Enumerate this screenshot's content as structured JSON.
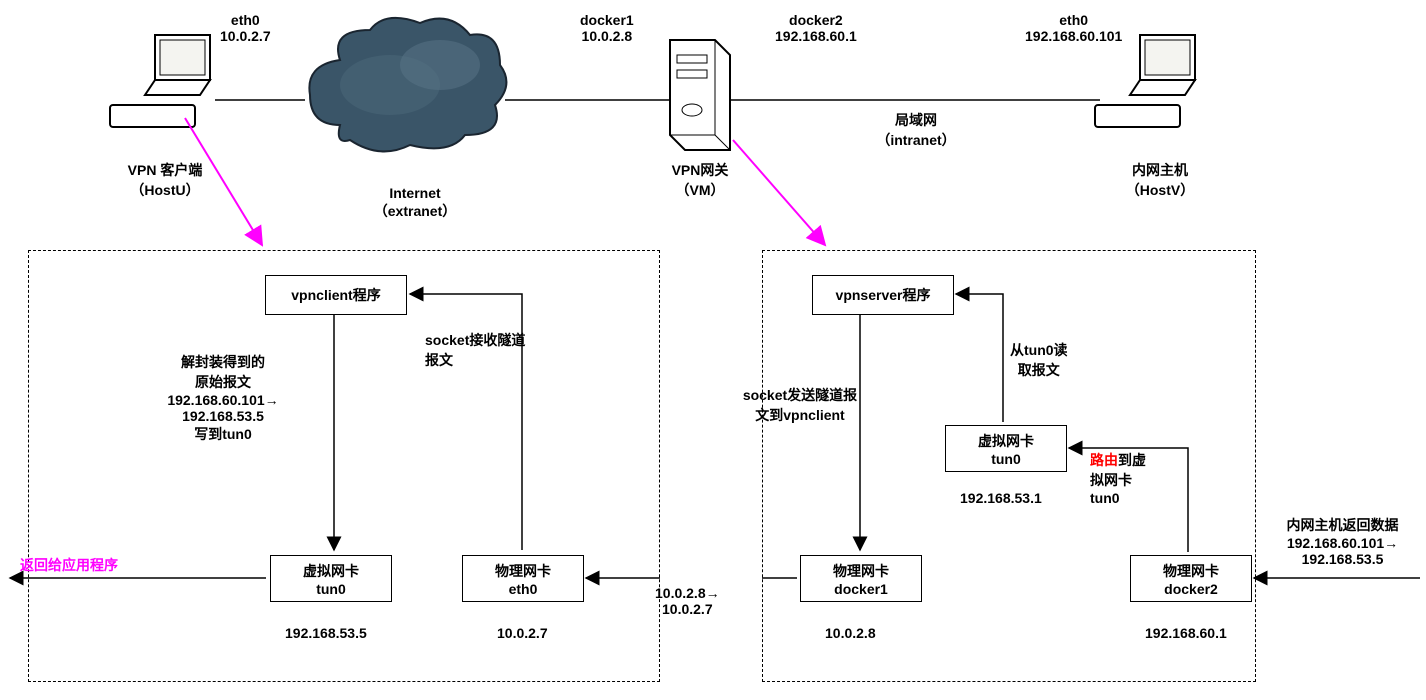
{
  "top": {
    "hostU": {
      "if": "eth0",
      "ip": "10.0.2.7",
      "name": "VPN 客户端",
      "sub": "（HostU）"
    },
    "internet": {
      "name": "Internet",
      "sub": "（extranet）"
    },
    "vm": {
      "if1": "docker1",
      "ip1": "10.0.2.8",
      "if2": "docker2",
      "ip2": "192.168.60.1",
      "name": "VPN网关",
      "sub": "（VM）"
    },
    "lan": {
      "name": "局域网",
      "sub": "（intranet）"
    },
    "hostV": {
      "if": "eth0",
      "ip": "192.168.60.101",
      "name": "内网主机",
      "sub": "（HostV）"
    }
  },
  "left": {
    "prog": "vpnclient程序",
    "decap1": "解封装得到的",
    "decap2": "原始报文",
    "decap3": "192.168.60.101→",
    "decap4": "192.168.53.5",
    "decap5": "写到tun0",
    "sock1": "socket接收隧道",
    "sock2": "报文",
    "vnic1": "虚拟网卡",
    "vnic2": "tun0",
    "vnicip": "192.168.53.5",
    "pnic1": "物理网卡",
    "pnic2": "eth0",
    "pnicip": "10.0.2.7",
    "out": "返回给应用程序"
  },
  "mid": {
    "l1": "10.0.2.8→",
    "l2": "10.0.2.7"
  },
  "right": {
    "prog": "vpnserver程序",
    "send1": "socket发送隧道报",
    "send2": "文到vpnclient",
    "read1": "从tun0读",
    "read2": "取报文",
    "vnic1": "虚拟网卡",
    "vnic2": "tun0",
    "vnicip": "192.168.53.1",
    "route1": "路由",
    "route2": "到虚",
    "route3": "拟网卡",
    "route4": "tun0",
    "p1a": "物理网卡",
    "p1b": "docker1",
    "p1ip": "10.0.2.8",
    "p2a": "物理网卡",
    "p2b": "docker2",
    "p2ip": "192.168.60.1",
    "in1": "内网主机返回数据",
    "in2": "192.168.60.101→",
    "in3": "192.168.53.5"
  }
}
